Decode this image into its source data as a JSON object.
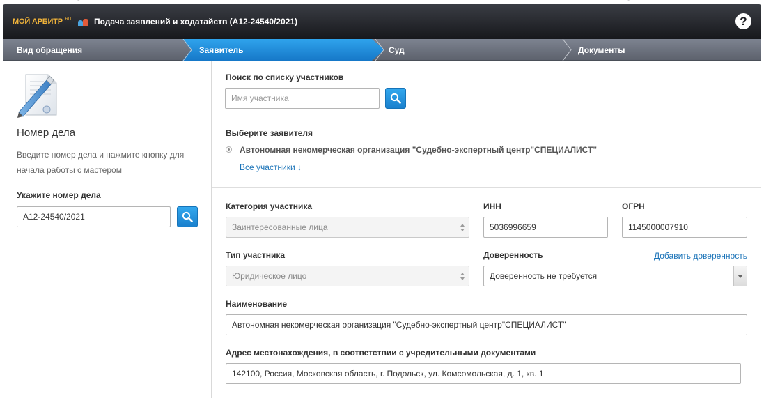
{
  "header": {
    "logo_main": "МОЙ АРБИТР",
    "logo_suffix": ".RU",
    "title": "Подача заявлений и ходатайств  (А12-24540/2021)",
    "help_label": "?"
  },
  "steps": [
    {
      "label": "Вид обращения",
      "active": false
    },
    {
      "label": "Заявитель",
      "active": true
    },
    {
      "label": "Суд",
      "active": false
    },
    {
      "label": "Документы",
      "active": false
    }
  ],
  "left": {
    "case_title": "Номер дела",
    "case_description": "Введите номер дела и нажмите кнопку для начала работы с мастером",
    "case_number_label": "Укажите номер дела",
    "case_number_value": "А12-24540/2021"
  },
  "right": {
    "search_label": "Поиск по списку участников",
    "search_placeholder": "Имя участника",
    "choose_label": "Выберите заявителя",
    "applicant_option": "Автономная некомерческая организация \"Судебно-экспертный центр\"СПЕЦИАЛИСТ\"",
    "all_participants_link": "Все участники ↓",
    "category_label": "Категория участника",
    "category_value": "Заинтересованные лица",
    "inn_label": "ИНН",
    "inn_value": "5036996659",
    "ogrn_label": "ОГРН",
    "ogrn_value": "1145000007910",
    "type_label": "Тип участника",
    "type_value": "Юридическое лицо",
    "power_label": "Доверенность",
    "add_power_link": "Добавить доверенность",
    "power_value": "Доверенность не требуется",
    "name_label": "Наименование",
    "name_value": "Автономная некомерческая организация \"Судебно-экспертный центр\"СПЕЦИАЛИСТ\"",
    "address_label": "Адрес местонахождения, в соответствии с учредительными документами",
    "address_value": "142100, Россия, Московская область, г. Подольск, ул. Комсомольская, д. 1, кв. 1"
  },
  "colors": {
    "accent": "#1a80cd",
    "logo": "#f0b33a",
    "header_bg": "#1b1c20",
    "steps_bg": "#6b707b",
    "link": "#1a73b8"
  }
}
